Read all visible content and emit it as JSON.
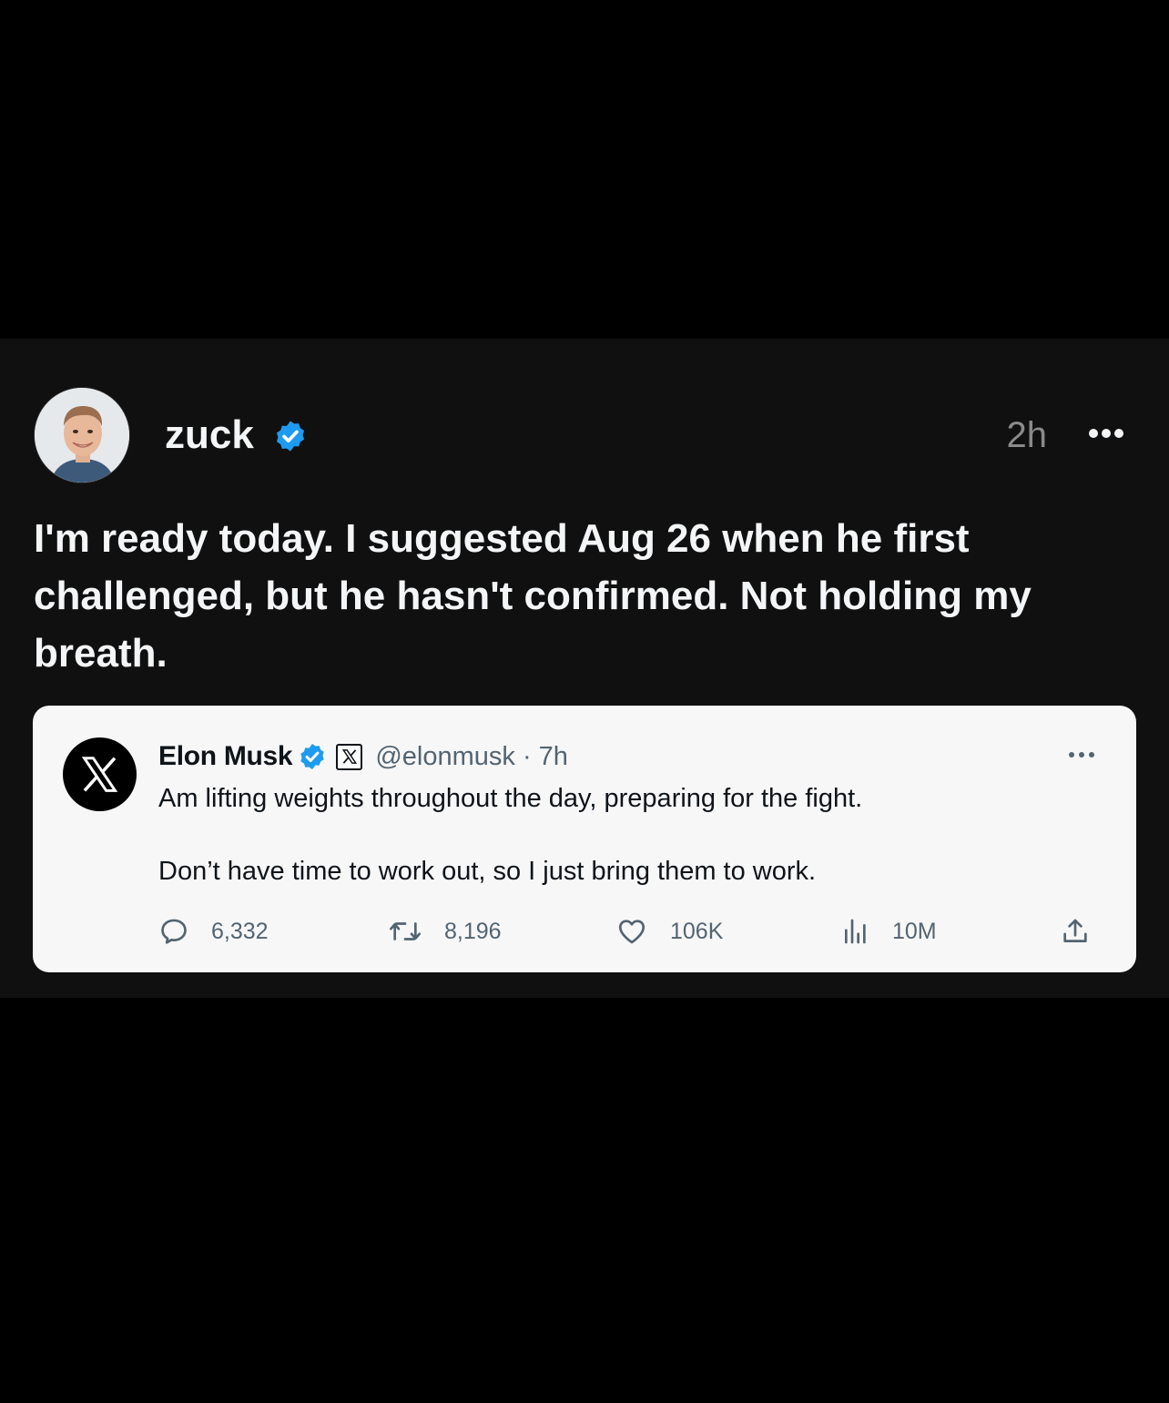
{
  "post": {
    "username": "zuck",
    "verified": true,
    "time": "2h",
    "more_icon": "more-horizontal-icon",
    "text": "I'm ready today. I suggested Aug 26 when he first challenged, but he hasn't confirmed. Not holding my breath.",
    "colors": {
      "background": "#101010",
      "text": "#f3f5f7",
      "muted": "#8a8a8a",
      "verified": "#1d9bf0"
    }
  },
  "quote": {
    "avatar_icon": "x-logo-icon",
    "name": "Elon Musk",
    "verified": true,
    "affiliate_badge_icon": "x-logo-icon",
    "handle_time": "@elonmusk · 7h",
    "text_line1": "Am lifting weights throughout the day, preparing for the fight.",
    "text_line2": "Don’t have time to work out, so I just bring them to work.",
    "more_icon": "more-horizontal-icon",
    "actions": {
      "reply": {
        "icon": "reply-icon",
        "count": "6,332"
      },
      "repost": {
        "icon": "repost-icon",
        "count": "8,196"
      },
      "like": {
        "icon": "heart-icon",
        "count": "106K"
      },
      "views": {
        "icon": "views-icon",
        "count": "10M"
      },
      "share": {
        "icon": "share-icon"
      }
    },
    "colors": {
      "card_background": "#f7f7f8",
      "text": "#0f1419",
      "muted": "#536471"
    }
  }
}
